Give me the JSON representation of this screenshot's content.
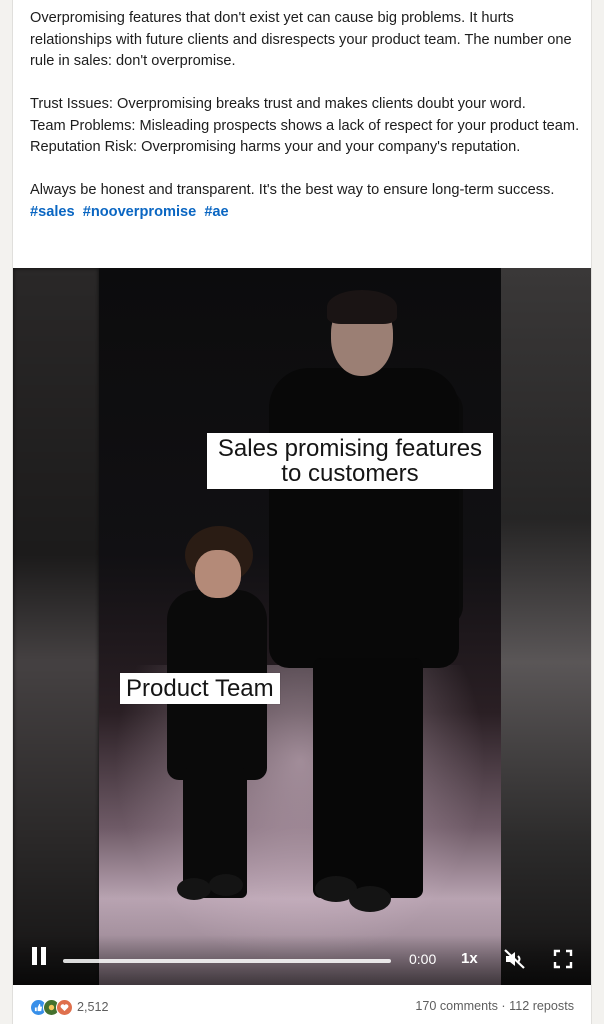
{
  "post": {
    "paragraph1": "Overpromising features that don't exist yet can cause big problems. It hurts relationships with future clients and disrespects your product team. The number one rule in sales: don't overpromise.",
    "line_trust": "Trust Issues: Overpromising breaks trust and makes clients doubt your word.",
    "line_team": "Team Problems: Misleading prospects shows a lack of respect for your product team.",
    "line_reputation": "Reputation Risk: Overpromising harms your and your company's reputation.",
    "paragraph3": "Always be honest and transparent. It's the best way to ensure long-term success.",
    "hashtags": [
      "#sales",
      "#nooverpromise",
      "#ae"
    ]
  },
  "video": {
    "caption_top": "Sales promising features to customers",
    "caption_bottom": "Product Team",
    "time": "0:00",
    "speed": "1x",
    "progress_fraction": 0.0,
    "state": "playing",
    "muted": true
  },
  "social": {
    "reaction_icons": [
      "like-icon",
      "celebrate-icon",
      "love-icon"
    ],
    "reaction_count": "2,512",
    "comments": "170 comments",
    "separator": "·",
    "reposts": "112 reposts"
  },
  "colors": {
    "hashtag": "#0a66c2",
    "like": "#378fe9",
    "celebrate": "#44712e",
    "love": "#df704d"
  }
}
